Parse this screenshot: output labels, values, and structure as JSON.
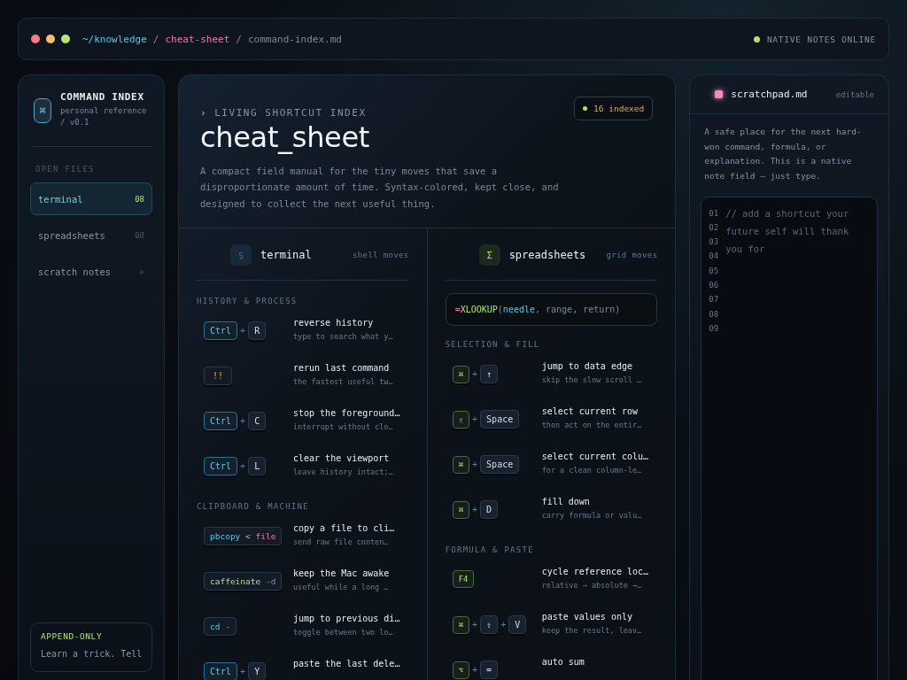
{
  "topbar": {
    "breadcrumb": [
      {
        "text": "~/knowledge",
        "kind": "root"
      },
      {
        "text": "cheat-sheet",
        "kind": "dir"
      },
      {
        "text": "command-index.md",
        "kind": "file"
      }
    ],
    "separator": "/",
    "status": {
      "label": "NATIVE NOTES ONLINE",
      "online": true
    }
  },
  "sidebar": {
    "logo_glyph": "⌘",
    "title": "COMMAND INDEX",
    "subtitle": "personal reference / v0.1",
    "section": "OPEN FILES",
    "items": [
      {
        "label": "terminal",
        "count": "08",
        "selected": true
      },
      {
        "label": "spreadsheets",
        "count": "08",
        "selected": false
      },
      {
        "label": "scratch notes",
        "count": "∞",
        "selected": false
      }
    ],
    "card": {
      "title": "APPEND-ONLY",
      "text": "Learn a trick. Tell"
    }
  },
  "main": {
    "eyebrow_marker": "›",
    "eyebrow": "LIVING SHORTCUT INDEX",
    "title": "cheat_sheet",
    "badge": "16 indexed",
    "description": "A compact field manual for the tiny moves that save a disproportionate amount of time. Syntax-colored, kept close, and designed to collect the next useful thing.",
    "columns": [
      {
        "glyph": "$",
        "kind": "terminal",
        "name": "terminal",
        "tag": "shell moves",
        "sections": [
          {
            "title": "HISTORY & PROCESS",
            "rows": [
              {
                "keys": [
                  {
                    "label": "Ctrl",
                    "kind": "mod"
                  },
                  {
                    "label": "+",
                    "kind": "plus"
                  },
                  {
                    "label": "R",
                    "kind": "plain"
                  }
                ],
                "title": "reverse history",
                "hint": "type to search what y…"
              },
              {
                "keys": [
                  {
                    "label": "!!",
                    "kind": "warn"
                  }
                ],
                "title": "rerun last command",
                "hint": "the fastest useful tw…"
              },
              {
                "keys": [
                  {
                    "label": "Ctrl",
                    "kind": "mod"
                  },
                  {
                    "label": "+",
                    "kind": "plus"
                  },
                  {
                    "label": "C",
                    "kind": "plain"
                  }
                ],
                "title": "stop the foreground…",
                "hint": "interrupt without clo…"
              },
              {
                "keys": [
                  {
                    "label": "Ctrl",
                    "kind": "mod"
                  },
                  {
                    "label": "+",
                    "kind": "plus"
                  },
                  {
                    "label": "L",
                    "kind": "plain"
                  }
                ],
                "title": "clear the viewport",
                "hint": "leave history intact;…"
              }
            ]
          },
          {
            "title": "CLIPBOARD & MACHINE",
            "rows": [
              {
                "keys": [
                  {
                    "kind": "snippet",
                    "tokens": [
                      {
                        "text": "pbcopy",
                        "kind": "cmd"
                      },
                      {
                        "text": "<",
                        "kind": "op"
                      },
                      {
                        "text": "file",
                        "kind": "arg"
                      }
                    ]
                  }
                ],
                "title": "copy a file to cli…",
                "hint": "send raw file conten…"
              },
              {
                "keys": [
                  {
                    "kind": "snippet",
                    "tokens": [
                      {
                        "text": "caffeinate",
                        "kind": "green"
                      },
                      {
                        "text": "-d",
                        "kind": "flag"
                      }
                    ]
                  }
                ],
                "title": "keep the Mac awake",
                "hint": "useful while a long …"
              },
              {
                "keys": [
                  {
                    "kind": "snippet",
                    "tokens": [
                      {
                        "text": "cd",
                        "kind": "cmd"
                      },
                      {
                        "text": "-",
                        "kind": "arg"
                      }
                    ]
                  }
                ],
                "title": "jump to previous di…",
                "hint": "toggle between two lo…"
              },
              {
                "keys": [
                  {
                    "label": "Ctrl",
                    "kind": "mod"
                  },
                  {
                    "label": "+",
                    "kind": "plus"
                  },
                  {
                    "label": "Y",
                    "kind": "plain"
                  }
                ],
                "title": "paste the last dele…"
              }
            ]
          }
        ]
      },
      {
        "glyph": "Σ",
        "kind": "sheet",
        "name": "spreadsheets",
        "tag": "grid moves",
        "formula": [
          {
            "text": "=",
            "kind": "arg"
          },
          {
            "text": "XLOOKUP",
            "kind": "green"
          },
          {
            "text": "(",
            "kind": "flag"
          },
          {
            "text": "needle",
            "kind": "cmd"
          },
          {
            "text": ", range, return)",
            "kind": "flag"
          }
        ],
        "sections": [
          {
            "title": "SELECTION & FILL",
            "rows": [
              {
                "keys": [
                  {
                    "label": "⌘",
                    "kind": "accent"
                  },
                  {
                    "label": "+",
                    "kind": "plus"
                  },
                  {
                    "label": "↑",
                    "kind": "plain"
                  }
                ],
                "title": "jump to data edge",
                "hint": "skip the slow scroll …"
              },
              {
                "keys": [
                  {
                    "label": "⇧",
                    "kind": "accent"
                  },
                  {
                    "label": "+",
                    "kind": "plus"
                  },
                  {
                    "label": "Space",
                    "kind": "plain"
                  }
                ],
                "title": "select current row",
                "hint": "then act on the entir…"
              },
              {
                "keys": [
                  {
                    "label": "⌘",
                    "kind": "accent"
                  },
                  {
                    "label": "+",
                    "kind": "plus"
                  },
                  {
                    "label": "Space",
                    "kind": "plain"
                  }
                ],
                "title": "select current colu…",
                "hint": "for a clean column-le…"
              },
              {
                "keys": [
                  {
                    "label": "⌘",
                    "kind": "accent"
                  },
                  {
                    "label": "+",
                    "kind": "plus"
                  },
                  {
                    "label": "D",
                    "kind": "plain"
                  }
                ],
                "title": "fill down",
                "hint": "carry formula or valu…"
              }
            ]
          },
          {
            "title": "FORMULA & PASTE",
            "rows": [
              {
                "keys": [
                  {
                    "label": "F4",
                    "kind": "accent"
                  }
                ],
                "title": "cycle reference loc…",
                "hint": "relative → absolute →…"
              },
              {
                "keys": [
                  {
                    "label": "⌘",
                    "kind": "accent"
                  },
                  {
                    "label": "+",
                    "kind": "plus"
                  },
                  {
                    "label": "⇧",
                    "kind": "plain"
                  },
                  {
                    "label": "+",
                    "kind": "plus"
                  },
                  {
                    "label": "V",
                    "kind": "plain"
                  }
                ],
                "title": "paste values only",
                "hint": "keep the result, leav…"
              },
              {
                "keys": [
                  {
                    "label": "⌥",
                    "kind": "accent"
                  },
                  {
                    "label": "+",
                    "kind": "plus"
                  },
                  {
                    "label": "=",
                    "kind": "plain"
                  }
                ],
                "title": "auto sum"
              }
            ]
          }
        ]
      }
    ]
  },
  "scratchpad": {
    "name": "scratchpad.md",
    "tag": "editable",
    "description": "A safe place for the next hard-won command, formula, or explanation. This is a native note field — just type.",
    "line_numbers": [
      "01",
      "02",
      "03",
      "04",
      "05",
      "06",
      "07",
      "08",
      "09"
    ],
    "placeholder": "// add a shortcut your future self will thank you for"
  }
}
